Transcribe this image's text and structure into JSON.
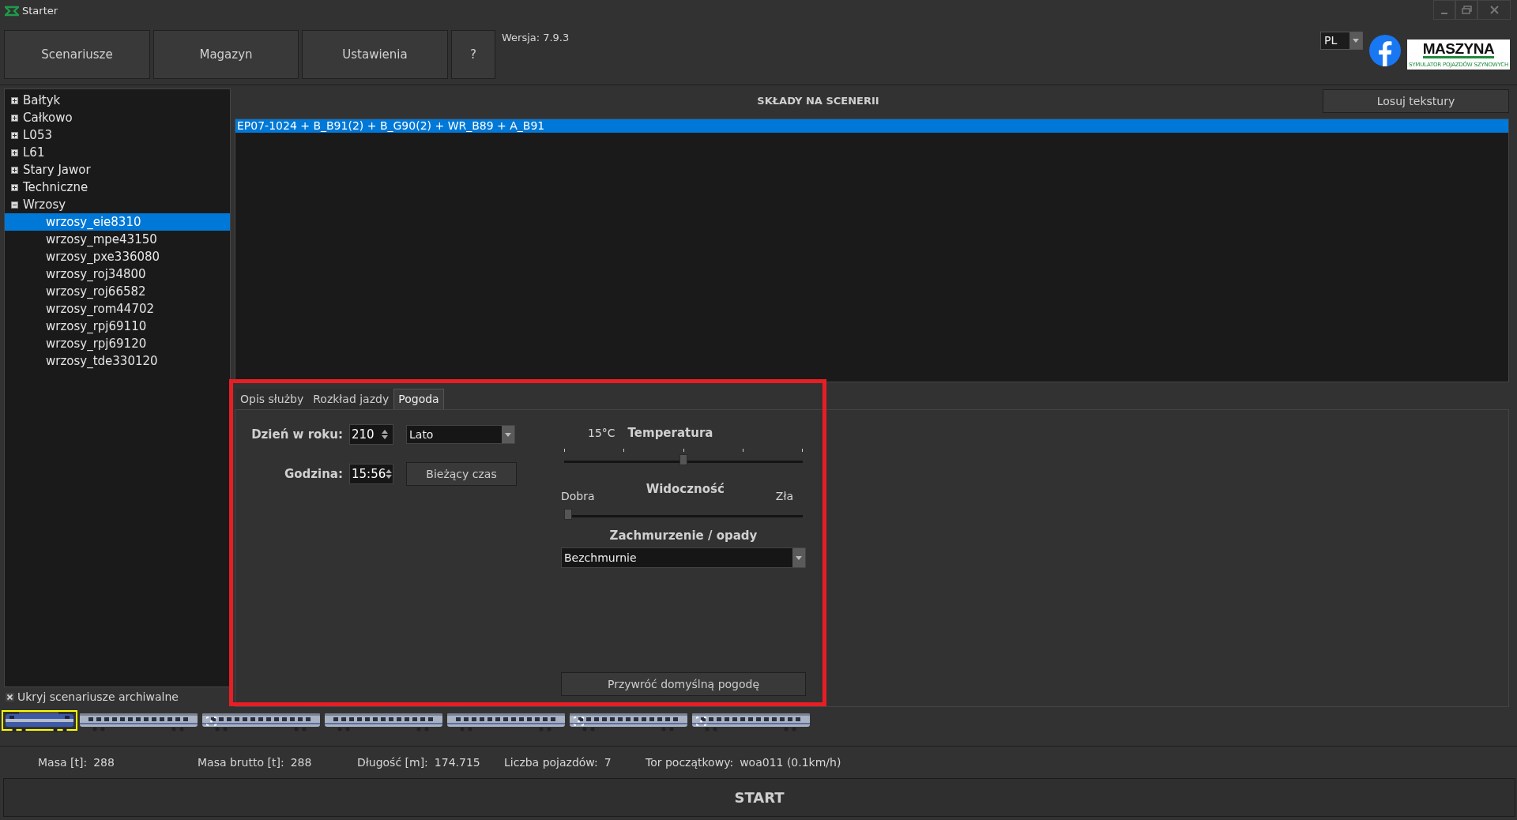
{
  "window": {
    "title": "Starter"
  },
  "toolbar": {
    "buttons": [
      {
        "label": "Scenariusze"
      },
      {
        "label": "Magazyn"
      },
      {
        "label": "Ustawienia"
      },
      {
        "label": "?"
      }
    ],
    "version_label": "Wersja:",
    "version": "7.9.3",
    "language": "PL"
  },
  "logo": {
    "title": "MASZYNA",
    "subtitle": "SYMULATOR POJAZDÓW SZYNOWYCH"
  },
  "scenarios": {
    "tree": [
      {
        "label": "Bałtyk",
        "expanded": false
      },
      {
        "label": "Całkowo",
        "expanded": false
      },
      {
        "label": "L053",
        "expanded": false
      },
      {
        "label": "L61",
        "expanded": false
      },
      {
        "label": "Stary Jawor",
        "expanded": false
      },
      {
        "label": "Techniczne",
        "expanded": false
      },
      {
        "label": "Wrzosy",
        "expanded": true,
        "children": [
          {
            "label": "wrzosy_eie8310",
            "selected": true
          },
          {
            "label": "wrzosy_mpe43150",
            "selected": false
          },
          {
            "label": "wrzosy_pxe336080",
            "selected": false
          },
          {
            "label": "wrzosy_roj34800",
            "selected": false
          },
          {
            "label": "wrzosy_roj66582",
            "selected": false
          },
          {
            "label": "wrzosy_rom44702",
            "selected": false
          },
          {
            "label": "wrzosy_rpj69110",
            "selected": false
          },
          {
            "label": "wrzosy_rpj69120",
            "selected": false
          },
          {
            "label": "wrzosy_tde330120",
            "selected": false
          }
        ]
      }
    ],
    "hide_archived": {
      "label": "Ukryj scenariusze archiwalne",
      "checked": true
    }
  },
  "consists": {
    "title": "SKŁADY NA SCENERII",
    "randomize_button": "Losuj tekstury",
    "items": [
      {
        "label": "EP07-1024 + B_B91(2) + B_G90(2) + WR_B89 + A_B91",
        "selected": true
      }
    ]
  },
  "tabs": [
    {
      "label": "Opis służby",
      "selected": false
    },
    {
      "label": "Rozkład jazdy",
      "selected": false
    },
    {
      "label": "Pogoda",
      "selected": true
    }
  ],
  "weather": {
    "day_label": "Dzień w roku:",
    "day": "210",
    "season": "Lato",
    "hour_label": "Godzina:",
    "hour": "15:56",
    "current_time_button": "Bieżący czas",
    "temperature_value": "15°C",
    "temperature_label": "Temperatura",
    "temperature": {
      "level": 0.5
    },
    "visibility_min": "Dobra",
    "visibility_label": "Widoczność",
    "visibility_max": "Zła",
    "visibility": {
      "level": 0
    },
    "clouds_label": "Zachmurzenie / opady",
    "clouds": "Bezchmurnie",
    "reset_button": "Przywróć domyślną pogodę"
  },
  "train": [
    {
      "kind": "locomotive",
      "selected": true,
      "coupling_mark": false
    },
    {
      "kind": "car",
      "selected": false,
      "coupling_mark": false
    },
    {
      "kind": "car",
      "selected": false,
      "coupling_mark": true
    },
    {
      "kind": "car",
      "selected": false,
      "coupling_mark": false
    },
    {
      "kind": "car",
      "selected": false,
      "coupling_mark": false
    },
    {
      "kind": "car",
      "selected": false,
      "coupling_mark": true
    },
    {
      "kind": "car",
      "selected": false,
      "coupling_mark": true
    }
  ],
  "status": [
    {
      "label": "Masa [t]:",
      "value": "288"
    },
    {
      "label": "Masa brutto [t]:",
      "value": "288"
    },
    {
      "label": "Długość [m]:",
      "value": "174.715"
    },
    {
      "label": "Liczba pojazdów:",
      "value": "7"
    },
    {
      "label": "Tor początkowy:",
      "value": "woa011 (0.1km/h)"
    }
  ],
  "start_button": "START"
}
